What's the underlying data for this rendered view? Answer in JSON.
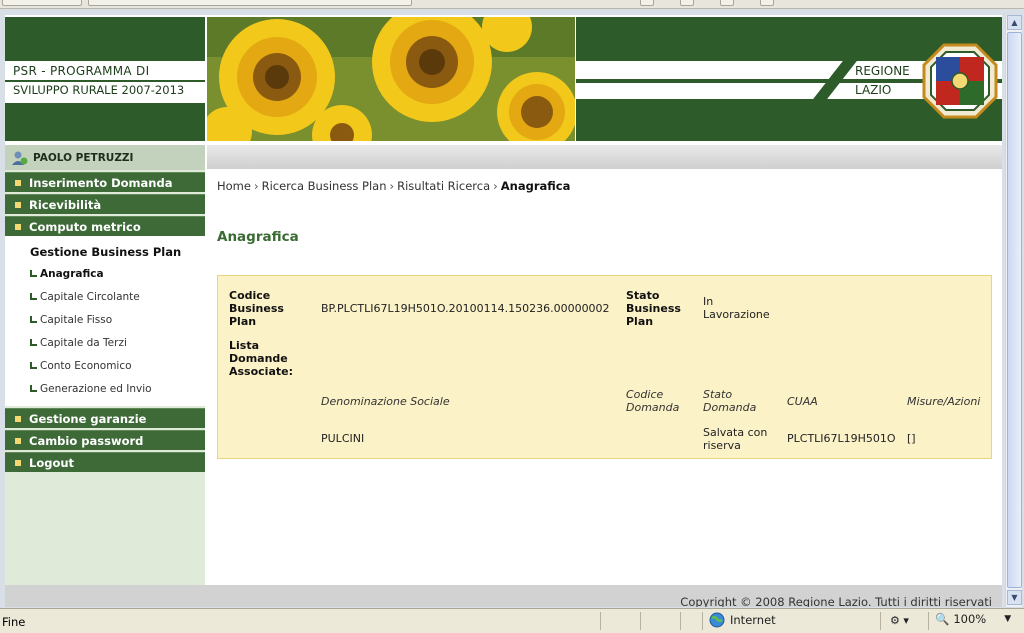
{
  "header": {
    "program_line1": "PSR  -  PROGRAMMA DI",
    "program_line2": "SVILUPPO RURALE 2007-2013",
    "region_line1": "REGIONE",
    "region_line2": "LAZIO"
  },
  "user": {
    "name": "PAOLO PETRUZZI"
  },
  "menu": {
    "top_items": [
      {
        "label": "Inserimento Domanda"
      },
      {
        "label": "Ricevibilità"
      },
      {
        "label": "Computo metrico"
      }
    ],
    "submenu_heading": "Gestione Business Plan",
    "sub_items": [
      {
        "label": "Anagrafica",
        "active": true
      },
      {
        "label": "Capitale Circolante"
      },
      {
        "label": "Capitale Fisso"
      },
      {
        "label": "Capitale da Terzi"
      },
      {
        "label": "Conto Economico"
      },
      {
        "label": "Generazione ed Invio"
      }
    ],
    "bottom_items": [
      {
        "label": "Gestione garanzie"
      },
      {
        "label": "Cambio password"
      },
      {
        "label": "Logout"
      }
    ]
  },
  "breadcrumb": {
    "items": [
      "Home",
      "Ricerca Business Plan",
      "Risultati Ricerca"
    ],
    "separator": "›",
    "current": "Anagrafica"
  },
  "page": {
    "title": "Anagrafica"
  },
  "info": {
    "codice_label": "Codice Business Plan",
    "codice_value": "BP.PLCTLI67L19H501O.20100114.150236.00000002",
    "stato_label": "Stato Business Plan",
    "stato_value": "In Lavorazione",
    "lista_label": "Lista Domande Associate:",
    "table": {
      "headers": [
        "Denominazione Sociale",
        "Codice Domanda",
        "Stato Domanda",
        "CUAA",
        "Misure/Azioni"
      ],
      "rows": [
        {
          "denominazione": "PULCINI",
          "codice": "",
          "stato": "Salvata con riserva",
          "cuaa": "PLCTLI67L19H501O",
          "misure": "[]"
        }
      ]
    }
  },
  "footer": {
    "text": "Copyright © 2008 Regione Lazio. Tutti i diritti riservati"
  },
  "statusbar": {
    "status": "Fine",
    "zone": "Internet",
    "zoom": "100%"
  }
}
